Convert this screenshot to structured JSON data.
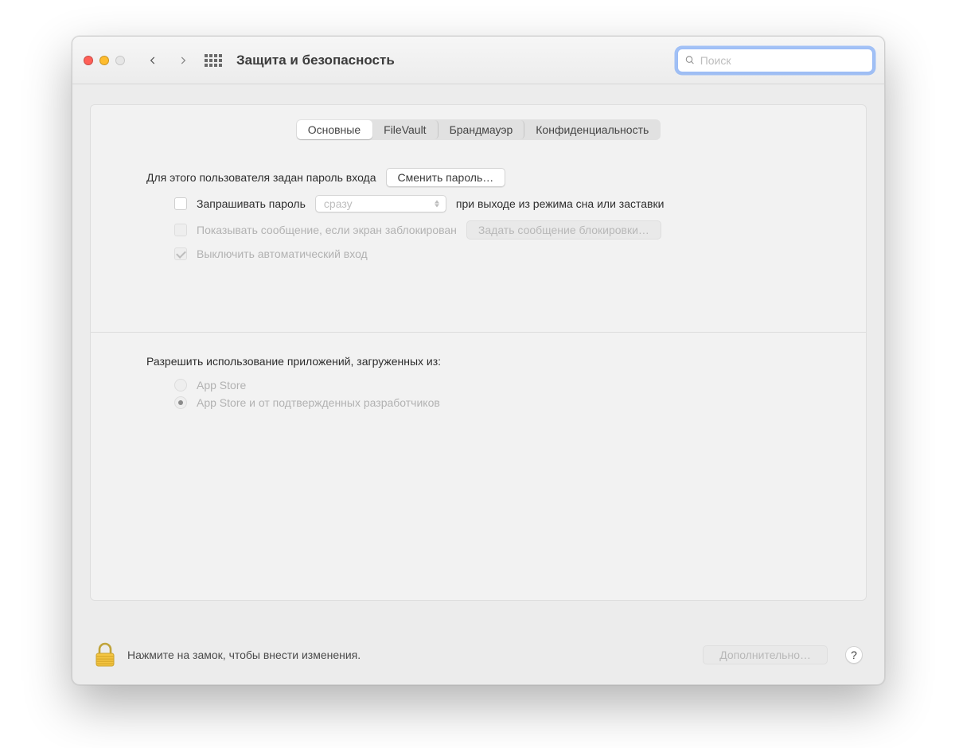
{
  "window_title": "Защита и безопасность",
  "search": {
    "placeholder": "Поиск",
    "value": ""
  },
  "tabs": [
    {
      "label": "Основные",
      "active": true
    },
    {
      "label": "FileVault",
      "active": false
    },
    {
      "label": "Брандмауэр",
      "active": false
    },
    {
      "label": "Конфиденциальность",
      "active": false
    }
  ],
  "login": {
    "password_set_label": "Для этого пользователя задан пароль входа",
    "change_password_button": "Сменить пароль…",
    "require_password_label": "Запрашивать пароль",
    "require_password_delay_selected": "сразу",
    "require_password_suffix": "при выходе из режима сна или заставки",
    "require_password_checked": false,
    "show_lock_message_label": "Показывать сообщение, если экран заблокирован",
    "set_lock_message_button": "Задать сообщение блокировки…",
    "disable_autologin_label": "Выключить автоматический вход",
    "disable_autologin_checked": true
  },
  "allow_apps": {
    "heading": "Разрешить использование приложений, загруженных из:",
    "options": [
      {
        "label": "App Store",
        "selected": false
      },
      {
        "label": "App Store и от подтвержденных разработчиков",
        "selected": true
      }
    ]
  },
  "footer": {
    "lock_hint": "Нажмите на замок, чтобы внести изменения.",
    "advanced_button": "Дополнительно…",
    "help": "?"
  }
}
